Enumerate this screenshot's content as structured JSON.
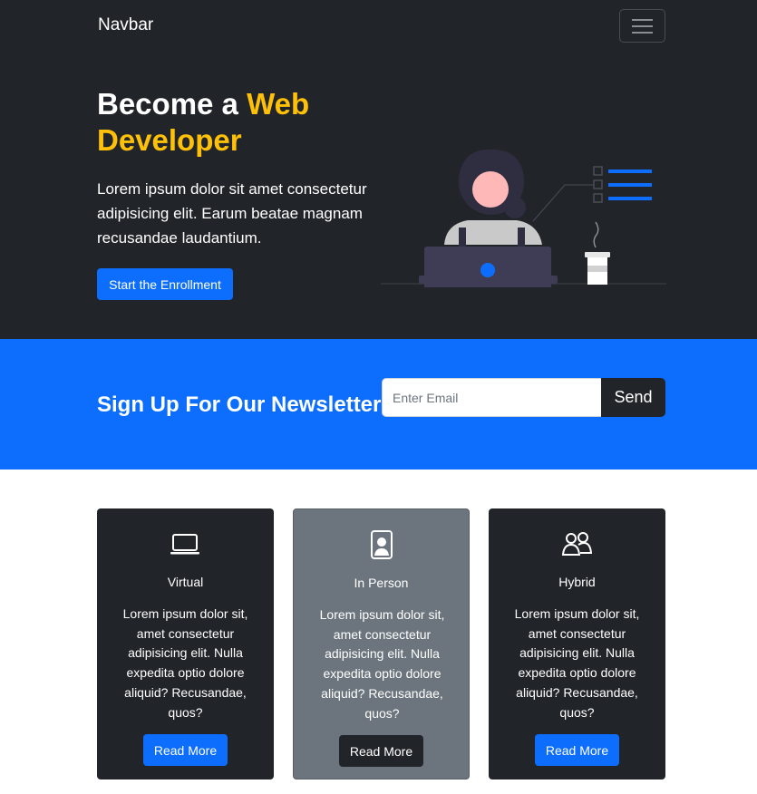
{
  "navbar": {
    "brand": "Navbar",
    "toggle_icon": "hamburger-menu-icon"
  },
  "hero": {
    "title_part1": "Become a",
    "title_accent_1": "Web",
    "title_accent_2": "Developer",
    "description": "Lorem ipsum dolor sit amet consectetur adipisicing elit. Earum beatae magnam recusandae laudantium.",
    "cta_label": "Start the Enrollment",
    "illustration": "developer-at-laptop-illustration"
  },
  "newsletter": {
    "title": "Sign Up For Our Newsletter",
    "email_placeholder": "Enter Email",
    "email_value": "",
    "send_label": "Send"
  },
  "cards": [
    {
      "icon": "laptop-icon",
      "title": "Virtual",
      "text": "Lorem ipsum dolor sit, amet consectetur adipisicing elit. Nulla expedita optio dolore aliquid? Recusandae, quos?",
      "button": "Read More"
    },
    {
      "icon": "person-badge-icon",
      "title": "In Person",
      "text": "Lorem ipsum dolor sit, amet consectetur adipisicing elit. Nulla expedita optio dolore aliquid? Recusandae, quos?",
      "button": "Read More"
    },
    {
      "icon": "people-icon",
      "title": "Hybrid",
      "text": "Lorem ipsum dolor sit, amet consectetur adipisicing elit. Nulla expedita optio dolore aliquid? Recusandae, quos?",
      "button": "Read More"
    }
  ],
  "colors": {
    "dark": "#212529",
    "primary": "#0d6efd",
    "accent": "#ffc107",
    "secondary": "#6c757d"
  }
}
